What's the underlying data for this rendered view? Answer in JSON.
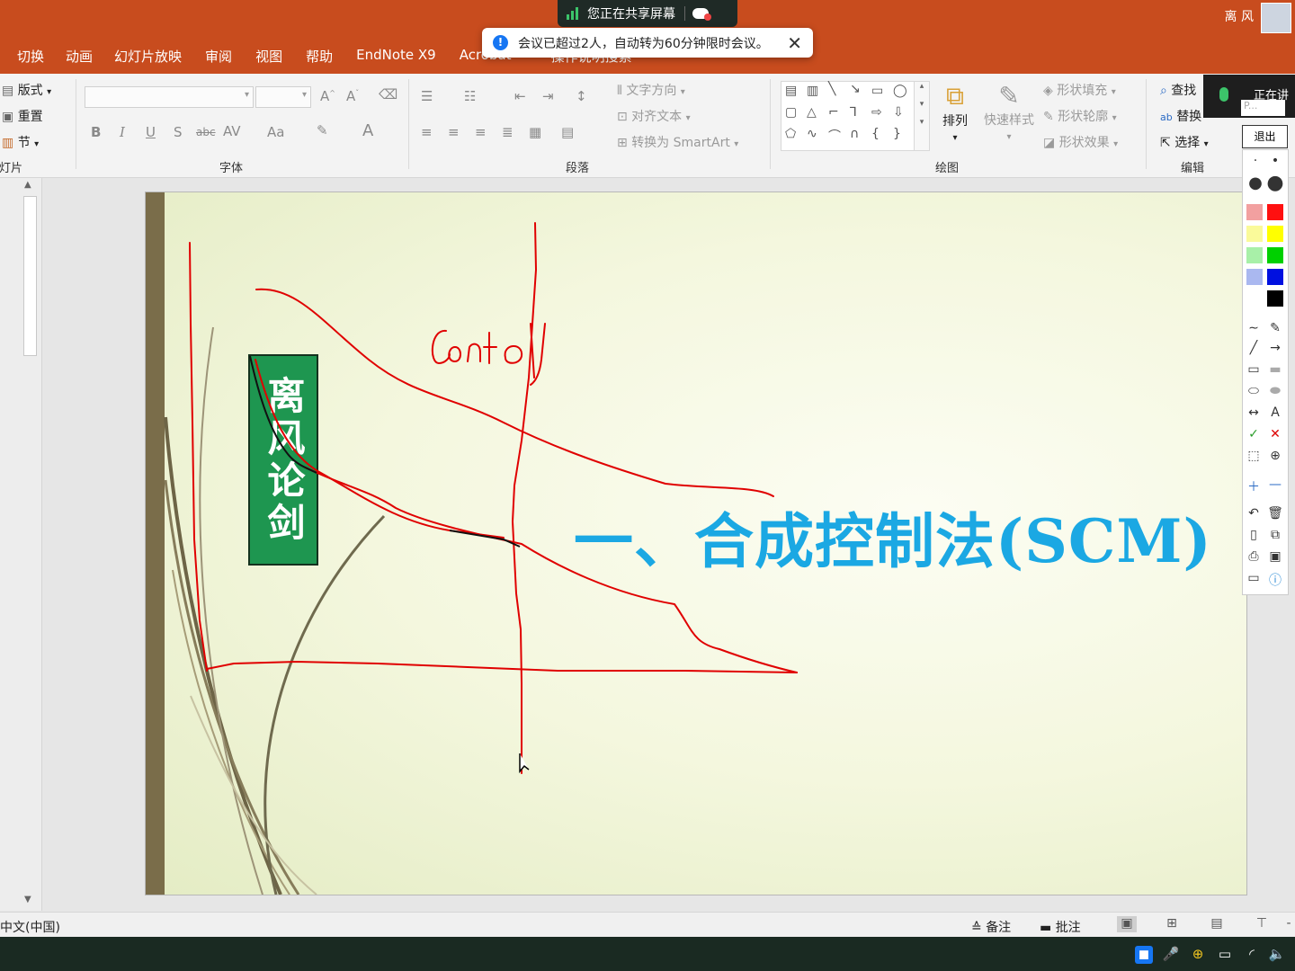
{
  "title_bar": {
    "menu_tabs": [
      "切换",
      "动画",
      "幻灯片放映",
      "审阅",
      "视图",
      "帮助",
      "EndNote X9",
      "Acrobat",
      "操作说明搜索"
    ],
    "user_name": "离 风"
  },
  "share": {
    "sharing_text": "您正在共享屏幕",
    "toast_message": "会议已超过2人，自动转为60分钟限时会议。"
  },
  "ribbon": {
    "slides_group": {
      "layout": "版式",
      "reset": "重置",
      "section": "节",
      "label": "幻灯片"
    },
    "font_group": {
      "label": "字体",
      "bold": "B",
      "italic": "I",
      "underline": "U",
      "shadow": "S",
      "strike": "abc",
      "spacing": "AV",
      "case": "Aa",
      "color": "A"
    },
    "paragraph_group": {
      "label": "段落",
      "text_direction": "文字方向",
      "align_text": "对齐文本",
      "smartart": "转换为 SmartArt"
    },
    "drawing_group": {
      "label": "绘图",
      "arrange": "排列",
      "quick_styles": "快速样式",
      "shape_fill": "形状填充",
      "shape_outline": "形状轮廓",
      "shape_effects": "形状效果"
    },
    "editing_group": {
      "label": "编辑",
      "find": "查找",
      "replace": "替换",
      "select": "选择"
    }
  },
  "slide": {
    "vertical_title": "离风论剑",
    "heading": "一、合成控制法(SCM)",
    "handwriting": "Control"
  },
  "pen_toolbar": {
    "exit": "退出",
    "speaking": "正在讲",
    "mini_placeholder": "P..."
  },
  "status_bar": {
    "language": "中文(中国)",
    "notes": "备注",
    "comments": "批注"
  },
  "colors": {
    "title_bar": "#c84c1e",
    "heading": "#1ba8e3",
    "title_box": "#1e9650",
    "ink": "#e00000"
  }
}
